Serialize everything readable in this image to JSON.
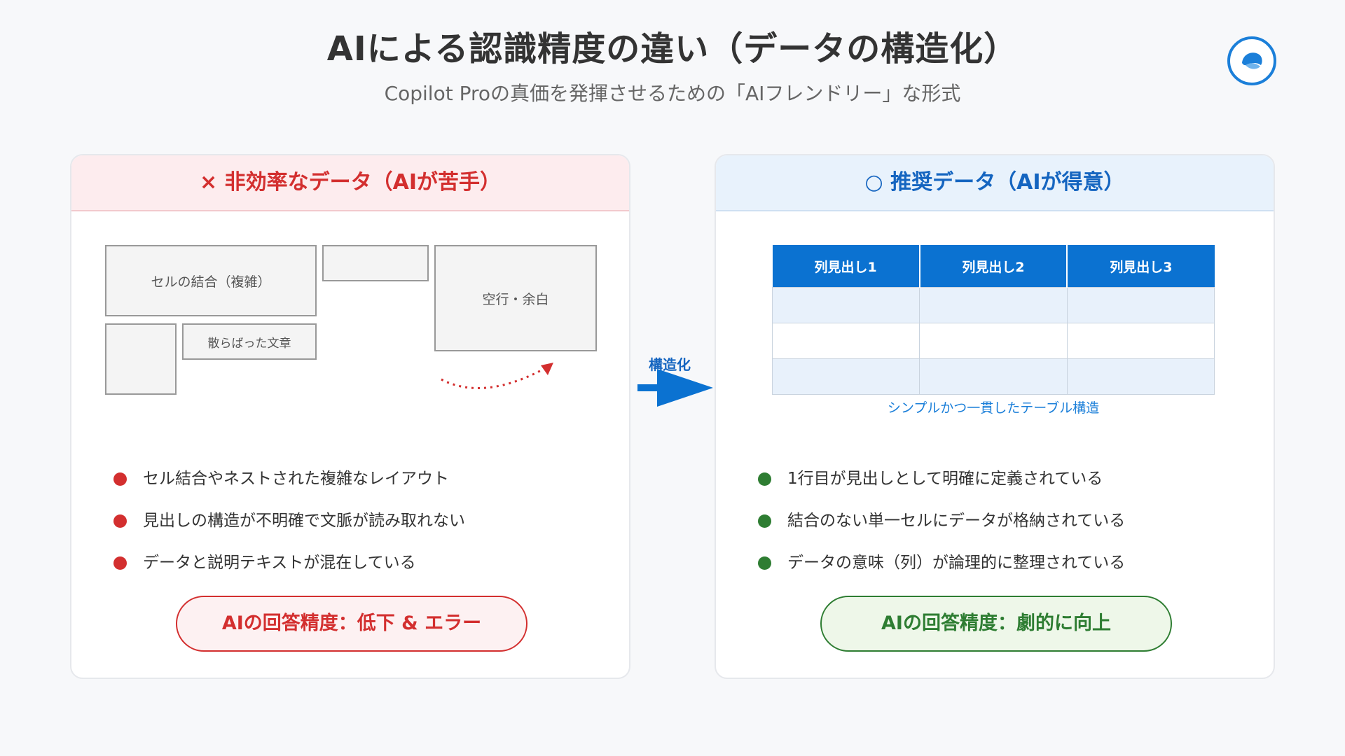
{
  "header": {
    "title": "AIによる認識精度の違い（データの構造化）",
    "subtitle": "Copilot Proの真価を発揮させるための「AIフレンドリー」な形式"
  },
  "colors": {
    "bad_accent": "#d32f2f",
    "good_accent": "#2e7d32",
    "blue_accent": "#0b72d1"
  },
  "left_panel": {
    "heading": "× 非効率なデータ（AIが苦手）",
    "diagram_labels": {
      "merged_cells": "セルの結合（複雑）",
      "scattered_text": "散らばった文章",
      "blank_rows": "空行・余白"
    },
    "bullets": [
      "セル結合やネストされた複雑なレイアウト",
      "見出しの構造が不明確で文脈が読み取れない",
      "データと説明テキストが混在している"
    ],
    "result": "AIの回答精度：低下 & エラー"
  },
  "arrow": {
    "label": "構造化"
  },
  "right_panel": {
    "heading": "○ 推奨データ（AIが得意）",
    "table": {
      "headers": [
        "列見出し1",
        "列見出し2",
        "列見出し3"
      ],
      "row_count": 3
    },
    "caption": "シンプルかつ一貫したテーブル構造",
    "bullets": [
      "1行目が見出しとして明確に定義されている",
      "結合のない単一セルにデータが格納されている",
      "データの意味（列）が論理的に整理されている"
    ],
    "result": "AIの回答精度：劇的に向上"
  }
}
